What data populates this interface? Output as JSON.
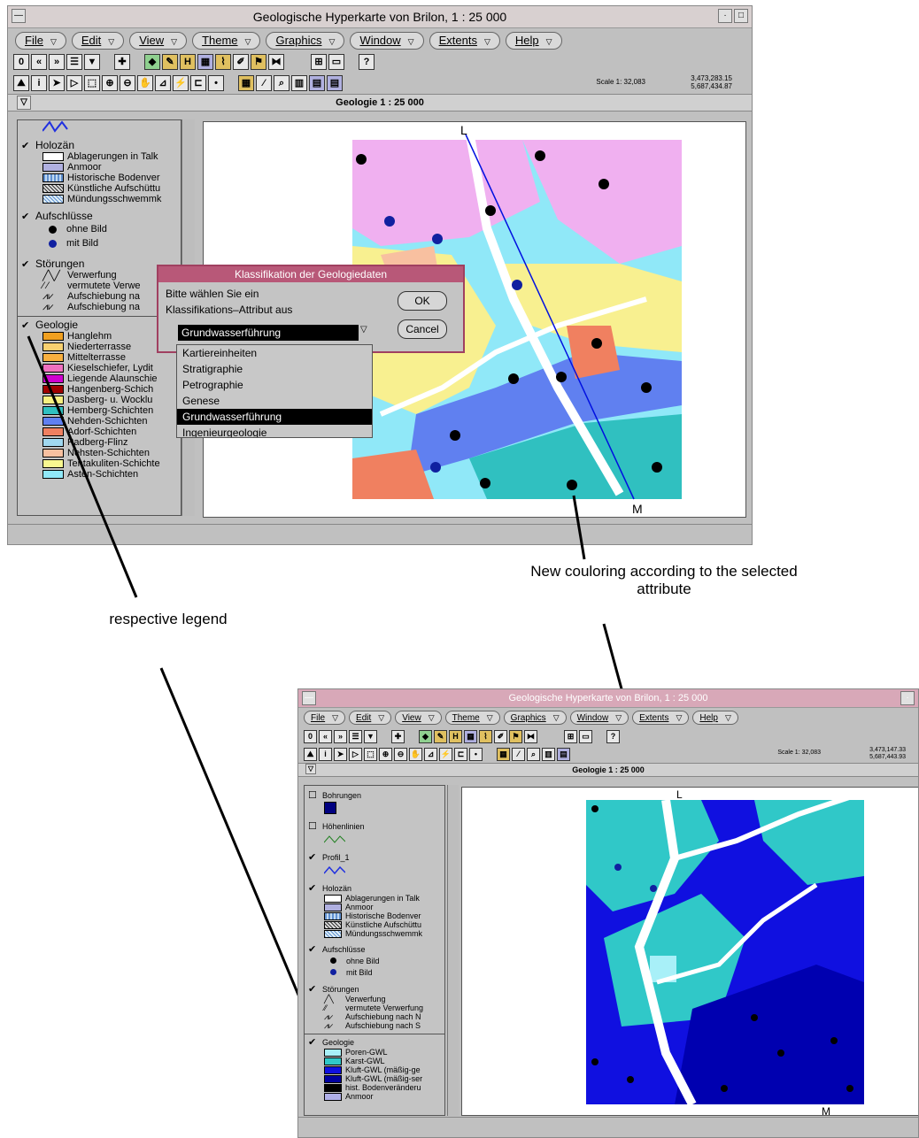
{
  "top_window": {
    "title": "Geologische Hyperkarte von Brilon, 1 : 25 000",
    "menus": [
      "File",
      "Edit",
      "View",
      "Theme",
      "Graphics",
      "Window",
      "Extents",
      "Help"
    ],
    "scale": "Scale 1: 32,083",
    "coords": [
      "3,473,283.15",
      "5,687,434.87"
    ],
    "view_title": "Geologie 1 : 25 000",
    "map_labels": {
      "top": "L",
      "bottom": "M"
    },
    "legend": {
      "holozaen": {
        "name": "Holozän",
        "items": [
          "Ablagerungen in Talk",
          "Anmoor",
          "Historische Bodenver",
          "Künstliche Aufschüttu",
          "Mündungsschwemmk"
        ]
      },
      "aufschluesse": {
        "name": "Aufschlüsse",
        "items": [
          "ohne Bild",
          "mit Bild"
        ]
      },
      "stoerungen": {
        "name": "Störungen",
        "items": [
          "Verwerfung",
          "vermutete Verwe",
          "Aufschiebung na",
          "Aufschiebung na"
        ]
      },
      "geologie": {
        "name": "Geologie",
        "items": [
          "Hanglehm",
          "Niederterrasse",
          "Mittelterrasse",
          "Kieselschiefer, Lydit",
          "Liegende Alaunschie",
          "Hangenberg-Schich",
          "Dasberg- u. Wocklu",
          "Hemberg-Schichten",
          "Nehden-Schichten",
          "Adorf-Schichten",
          "Padberg-Flinz",
          "Nehsten-Schichten",
          "Tentakuliten-Schichte",
          "Asten-Schichten"
        ]
      },
      "geologie_colors": [
        "#f0a020",
        "#f8d070",
        "#f8b040",
        "#f070c0",
        "#d000d0",
        "#a00000",
        "#f8f080",
        "#30c0c0",
        "#6080f0",
        "#f08060",
        "#a0d8f0",
        "#f8c0a0",
        "#f8f890",
        "#90e8f8"
      ]
    },
    "dialog": {
      "title": "Klassifikation der Geologiedaten",
      "text1": "Bitte wählen Sie ein",
      "text2": "Klassifikations–Attribut aus",
      "ok": "OK",
      "cancel": "Cancel",
      "selected": "Grundwasserführung",
      "options": [
        "Kartiereinheiten",
        "Stratigraphie",
        "Petrographie",
        "Genese",
        "Grundwasserführung",
        "Ingenieurgeologie"
      ]
    }
  },
  "annotations": {
    "coloring": "New couloring according to the selected attribute",
    "legend": "respective legend"
  },
  "bottom_window": {
    "title": "Geologische Hyperkarte von Brilon, 1 : 25 000",
    "menus": [
      "File",
      "Edit",
      "View",
      "Theme",
      "Graphics",
      "Window",
      "Extents",
      "Help"
    ],
    "scale": "Scale 1: 32,083",
    "coords": [
      "3,473,147.33",
      "5,687,443.93"
    ],
    "view_title": "Geologie 1 : 25 000",
    "map_labels": {
      "top": "L",
      "bottom": "M"
    },
    "legend": {
      "bohrungen": "Bohrungen",
      "hoehenlinien": "Höhenlinien",
      "profil": "Profil_1",
      "holozaen": {
        "name": "Holozän",
        "items": [
          "Ablagerungen in Talk",
          "Anmoor",
          "Historische Bodenver",
          "Künstliche Aufschüttu",
          "Mündungsschwemmk"
        ]
      },
      "aufschluesse": {
        "name": "Aufschlüsse",
        "items": [
          "ohne Bild",
          "mit Bild"
        ]
      },
      "stoerungen": {
        "name": "Störungen",
        "items": [
          "Verwerfung",
          "vermutete Verwerfung",
          "Aufschiebung nach N",
          "Aufschiebung nach S"
        ]
      },
      "geologie": {
        "name": "Geologie",
        "items": [
          "Poren-GWL",
          "Karst-GWL",
          "Kluft-GWL (mäßig-ge",
          "Kluft-GWL (mäßig-ser",
          "hist. Bodenveränderu",
          "Anmoor"
        ]
      },
      "geologie_colors": [
        "#a8f0f8",
        "#30c8c8",
        "#1010e0",
        "#0000a0",
        "#000000",
        "#b0b0e8"
      ]
    }
  }
}
